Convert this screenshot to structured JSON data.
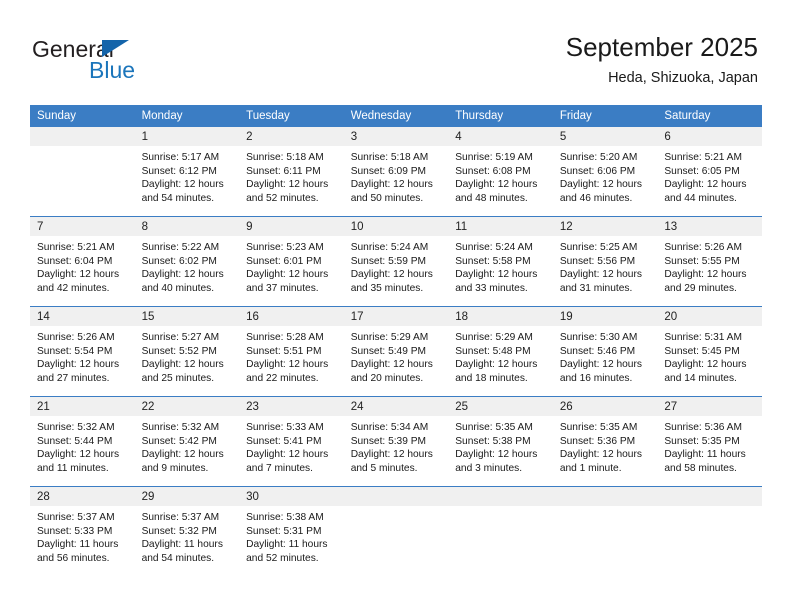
{
  "brand": {
    "name_dark": "General",
    "name_blue": "Blue",
    "triangle_color": "#1464aa",
    "blue_color": "#1b75bb"
  },
  "header": {
    "title": "September 2025",
    "subtitle": "Heda, Shizuoka, Japan",
    "header_bg": "#3b7dc4",
    "daynum_bg": "#f0f0f0"
  },
  "weekday_headers": [
    "Sunday",
    "Monday",
    "Tuesday",
    "Wednesday",
    "Thursday",
    "Friday",
    "Saturday"
  ],
  "weeks": [
    [
      {
        "day": "",
        "sunrise": "",
        "sunset": "",
        "daylight_line1": "",
        "daylight_line2": ""
      },
      {
        "day": "1",
        "sunrise": "Sunrise: 5:17 AM",
        "sunset": "Sunset: 6:12 PM",
        "daylight_line1": "Daylight: 12 hours",
        "daylight_line2": "and 54 minutes."
      },
      {
        "day": "2",
        "sunrise": "Sunrise: 5:18 AM",
        "sunset": "Sunset: 6:11 PM",
        "daylight_line1": "Daylight: 12 hours",
        "daylight_line2": "and 52 minutes."
      },
      {
        "day": "3",
        "sunrise": "Sunrise: 5:18 AM",
        "sunset": "Sunset: 6:09 PM",
        "daylight_line1": "Daylight: 12 hours",
        "daylight_line2": "and 50 minutes."
      },
      {
        "day": "4",
        "sunrise": "Sunrise: 5:19 AM",
        "sunset": "Sunset: 6:08 PM",
        "daylight_line1": "Daylight: 12 hours",
        "daylight_line2": "and 48 minutes."
      },
      {
        "day": "5",
        "sunrise": "Sunrise: 5:20 AM",
        "sunset": "Sunset: 6:06 PM",
        "daylight_line1": "Daylight: 12 hours",
        "daylight_line2": "and 46 minutes."
      },
      {
        "day": "6",
        "sunrise": "Sunrise: 5:21 AM",
        "sunset": "Sunset: 6:05 PM",
        "daylight_line1": "Daylight: 12 hours",
        "daylight_line2": "and 44 minutes."
      }
    ],
    [
      {
        "day": "7",
        "sunrise": "Sunrise: 5:21 AM",
        "sunset": "Sunset: 6:04 PM",
        "daylight_line1": "Daylight: 12 hours",
        "daylight_line2": "and 42 minutes."
      },
      {
        "day": "8",
        "sunrise": "Sunrise: 5:22 AM",
        "sunset": "Sunset: 6:02 PM",
        "daylight_line1": "Daylight: 12 hours",
        "daylight_line2": "and 40 minutes."
      },
      {
        "day": "9",
        "sunrise": "Sunrise: 5:23 AM",
        "sunset": "Sunset: 6:01 PM",
        "daylight_line1": "Daylight: 12 hours",
        "daylight_line2": "and 37 minutes."
      },
      {
        "day": "10",
        "sunrise": "Sunrise: 5:24 AM",
        "sunset": "Sunset: 5:59 PM",
        "daylight_line1": "Daylight: 12 hours",
        "daylight_line2": "and 35 minutes."
      },
      {
        "day": "11",
        "sunrise": "Sunrise: 5:24 AM",
        "sunset": "Sunset: 5:58 PM",
        "daylight_line1": "Daylight: 12 hours",
        "daylight_line2": "and 33 minutes."
      },
      {
        "day": "12",
        "sunrise": "Sunrise: 5:25 AM",
        "sunset": "Sunset: 5:56 PM",
        "daylight_line1": "Daylight: 12 hours",
        "daylight_line2": "and 31 minutes."
      },
      {
        "day": "13",
        "sunrise": "Sunrise: 5:26 AM",
        "sunset": "Sunset: 5:55 PM",
        "daylight_line1": "Daylight: 12 hours",
        "daylight_line2": "and 29 minutes."
      }
    ],
    [
      {
        "day": "14",
        "sunrise": "Sunrise: 5:26 AM",
        "sunset": "Sunset: 5:54 PM",
        "daylight_line1": "Daylight: 12 hours",
        "daylight_line2": "and 27 minutes."
      },
      {
        "day": "15",
        "sunrise": "Sunrise: 5:27 AM",
        "sunset": "Sunset: 5:52 PM",
        "daylight_line1": "Daylight: 12 hours",
        "daylight_line2": "and 25 minutes."
      },
      {
        "day": "16",
        "sunrise": "Sunrise: 5:28 AM",
        "sunset": "Sunset: 5:51 PM",
        "daylight_line1": "Daylight: 12 hours",
        "daylight_line2": "and 22 minutes."
      },
      {
        "day": "17",
        "sunrise": "Sunrise: 5:29 AM",
        "sunset": "Sunset: 5:49 PM",
        "daylight_line1": "Daylight: 12 hours",
        "daylight_line2": "and 20 minutes."
      },
      {
        "day": "18",
        "sunrise": "Sunrise: 5:29 AM",
        "sunset": "Sunset: 5:48 PM",
        "daylight_line1": "Daylight: 12 hours",
        "daylight_line2": "and 18 minutes."
      },
      {
        "day": "19",
        "sunrise": "Sunrise: 5:30 AM",
        "sunset": "Sunset: 5:46 PM",
        "daylight_line1": "Daylight: 12 hours",
        "daylight_line2": "and 16 minutes."
      },
      {
        "day": "20",
        "sunrise": "Sunrise: 5:31 AM",
        "sunset": "Sunset: 5:45 PM",
        "daylight_line1": "Daylight: 12 hours",
        "daylight_line2": "and 14 minutes."
      }
    ],
    [
      {
        "day": "21",
        "sunrise": "Sunrise: 5:32 AM",
        "sunset": "Sunset: 5:44 PM",
        "daylight_line1": "Daylight: 12 hours",
        "daylight_line2": "and 11 minutes."
      },
      {
        "day": "22",
        "sunrise": "Sunrise: 5:32 AM",
        "sunset": "Sunset: 5:42 PM",
        "daylight_line1": "Daylight: 12 hours",
        "daylight_line2": "and 9 minutes."
      },
      {
        "day": "23",
        "sunrise": "Sunrise: 5:33 AM",
        "sunset": "Sunset: 5:41 PM",
        "daylight_line1": "Daylight: 12 hours",
        "daylight_line2": "and 7 minutes."
      },
      {
        "day": "24",
        "sunrise": "Sunrise: 5:34 AM",
        "sunset": "Sunset: 5:39 PM",
        "daylight_line1": "Daylight: 12 hours",
        "daylight_line2": "and 5 minutes."
      },
      {
        "day": "25",
        "sunrise": "Sunrise: 5:35 AM",
        "sunset": "Sunset: 5:38 PM",
        "daylight_line1": "Daylight: 12 hours",
        "daylight_line2": "and 3 minutes."
      },
      {
        "day": "26",
        "sunrise": "Sunrise: 5:35 AM",
        "sunset": "Sunset: 5:36 PM",
        "daylight_line1": "Daylight: 12 hours",
        "daylight_line2": "and 1 minute."
      },
      {
        "day": "27",
        "sunrise": "Sunrise: 5:36 AM",
        "sunset": "Sunset: 5:35 PM",
        "daylight_line1": "Daylight: 11 hours",
        "daylight_line2": "and 58 minutes."
      }
    ],
    [
      {
        "day": "28",
        "sunrise": "Sunrise: 5:37 AM",
        "sunset": "Sunset: 5:33 PM",
        "daylight_line1": "Daylight: 11 hours",
        "daylight_line2": "and 56 minutes."
      },
      {
        "day": "29",
        "sunrise": "Sunrise: 5:37 AM",
        "sunset": "Sunset: 5:32 PM",
        "daylight_line1": "Daylight: 11 hours",
        "daylight_line2": "and 54 minutes."
      },
      {
        "day": "30",
        "sunrise": "Sunrise: 5:38 AM",
        "sunset": "Sunset: 5:31 PM",
        "daylight_line1": "Daylight: 11 hours",
        "daylight_line2": "and 52 minutes."
      },
      {
        "day": "",
        "sunrise": "",
        "sunset": "",
        "daylight_line1": "",
        "daylight_line2": ""
      },
      {
        "day": "",
        "sunrise": "",
        "sunset": "",
        "daylight_line1": "",
        "daylight_line2": ""
      },
      {
        "day": "",
        "sunrise": "",
        "sunset": "",
        "daylight_line1": "",
        "daylight_line2": ""
      },
      {
        "day": "",
        "sunrise": "",
        "sunset": "",
        "daylight_line1": "",
        "daylight_line2": ""
      }
    ]
  ]
}
